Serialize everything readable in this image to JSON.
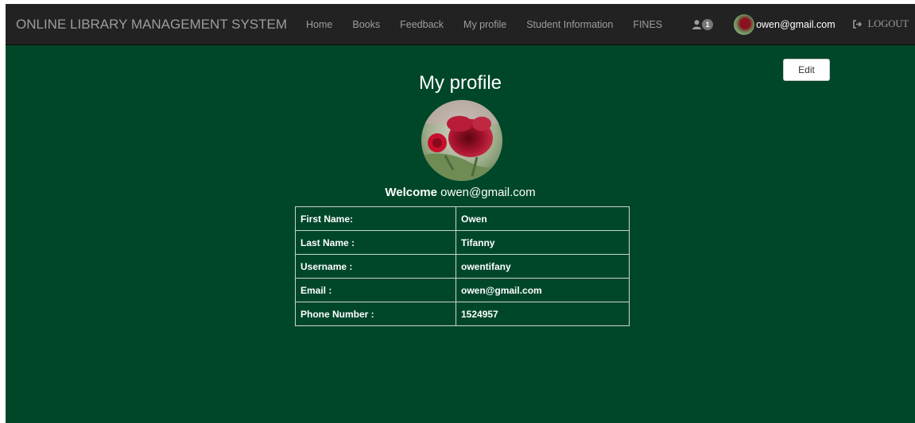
{
  "header": {
    "brand": "ONLINE LIBRARY MANAGEMENT SYSTEM",
    "nav": [
      "Home",
      "Books",
      "Feedback",
      "My profile",
      "Student Information",
      "FINES"
    ],
    "notification_count": "1",
    "user_email": "owen@gmail.com",
    "logout_label": "LOGOUT"
  },
  "profile": {
    "edit_label": "Edit",
    "title": "My profile",
    "welcome_label": "Welcome",
    "welcome_email": "owen@gmail.com",
    "rows": [
      {
        "label": "First Name:",
        "value": "Owen"
      },
      {
        "label": "Last Name :",
        "value": "Tifanny"
      },
      {
        "label": "Username :",
        "value": "owentifany"
      },
      {
        "label": "Email :",
        "value": "owen@gmail.com"
      },
      {
        "label": "Phone Number :",
        "value": "1524957"
      }
    ]
  },
  "icons": {
    "notification": "user-icon",
    "logout": "logout-icon"
  },
  "colors": {
    "navbar": "#222222",
    "background": "#00472a",
    "nav_text": "#9d9d9d"
  }
}
